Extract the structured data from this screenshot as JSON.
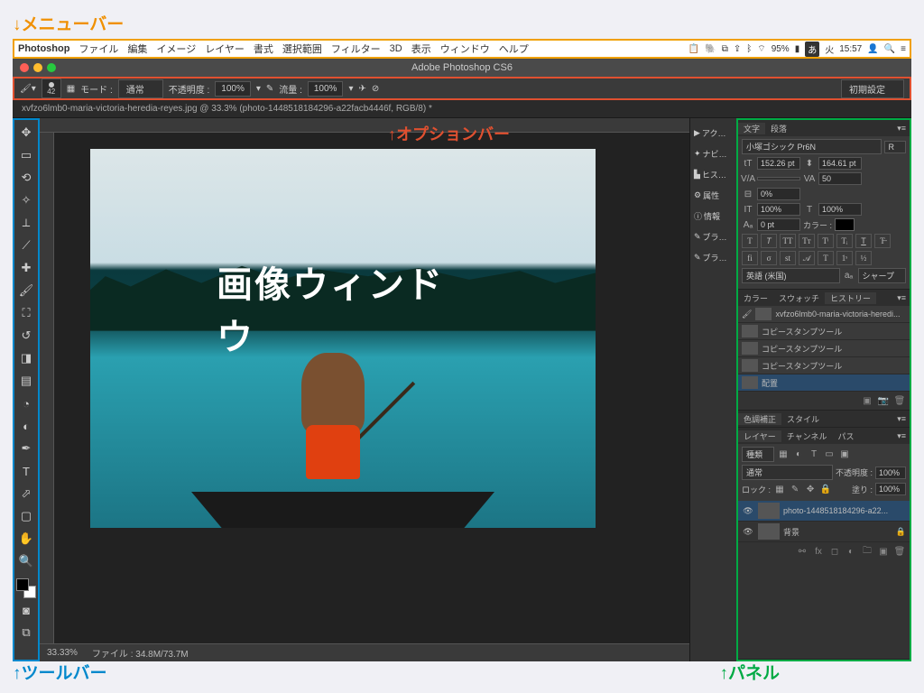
{
  "annotations": {
    "menubar": "↓メニューバー",
    "optionbar": "オプションバー",
    "toolbar": "↑ツールバー",
    "panel": "↑パネル"
  },
  "menubar": {
    "app": "Photoshop",
    "items": [
      "ファイル",
      "編集",
      "イメージ",
      "レイヤー",
      "書式",
      "選択範囲",
      "フィルター",
      "3D",
      "表示",
      "ウィンドウ",
      "ヘルプ"
    ],
    "battery": "95%",
    "ime": "あ",
    "day": "火",
    "time": "15:57"
  },
  "titlebar": {
    "title": "Adobe Photoshop CS6"
  },
  "optionbar": {
    "brushsize": "42",
    "mode_label": "モード :",
    "mode_value": "通常",
    "opacity_label": "不透明度 :",
    "opacity_value": "100%",
    "flow_label": "流量 :",
    "flow_value": "100%",
    "preset": "初期設定"
  },
  "doctab": {
    "label": "xvfzo6lmb0-maria-victoria-heredia-reyes.jpg @ 33.3% (photo-1448518184296-a22facb4446f, RGB/8) *"
  },
  "canvas": {
    "overlay": "画像ウィンドウ"
  },
  "statusbar": {
    "zoom": "33.33%",
    "fileinfo": "ファイル : 34.8M/73.7M"
  },
  "side_panels": {
    "items": [
      "アク…",
      "ナビ…",
      "ヒス…",
      "属性",
      "情報",
      "ブラ…",
      "ブラ…"
    ]
  },
  "character_panel": {
    "tabs": [
      "文字",
      "段落"
    ],
    "font": "小塚ゴシック Pr6N",
    "weight": "R",
    "size": "152.26 pt",
    "leading": "164.61 pt",
    "tracking": "50",
    "baseline": "0%",
    "hscale": "100%",
    "vscale": "100%",
    "shift": "0 pt",
    "color_label": "カラー :",
    "lang": "英語 (米国)",
    "aa": "シャープ"
  },
  "history_panel": {
    "tabs": [
      "カラー",
      "スウォッチ",
      "ヒストリー"
    ],
    "snapshot": "xvfzo6lmb0-maria-victoria-heredi...",
    "items": [
      "コピースタンプツール",
      "コピースタンプツール",
      "コピースタンプツール",
      "配置"
    ]
  },
  "adjust_panel": {
    "tabs": [
      "色調補正",
      "スタイル"
    ]
  },
  "layers_panel": {
    "tabs": [
      "レイヤー",
      "チャンネル",
      "パス"
    ],
    "kind": "種類",
    "blend": "通常",
    "opacity_label": "不透明度 :",
    "opacity": "100%",
    "lock_label": "ロック :",
    "fill_label": "塗り :",
    "fill": "100%",
    "layers": [
      {
        "name": "photo-1448518184296-a22..."
      },
      {
        "name": "背景"
      }
    ]
  }
}
